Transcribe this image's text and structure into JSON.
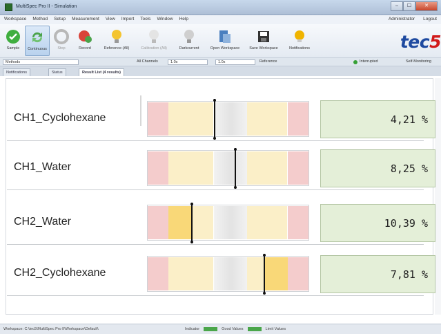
{
  "window": {
    "title": "MultiSpec Pro II - Simulation",
    "controls": [
      "–",
      "☐",
      "✕"
    ]
  },
  "menu": {
    "items": [
      "Workspace",
      "Method",
      "Setup",
      "Measurement",
      "View",
      "Import",
      "Tools",
      "Window",
      "Help"
    ],
    "right": [
      "Administrator",
      "Logout"
    ]
  },
  "toolbar": {
    "buttons": [
      {
        "label": "Sample",
        "icon": "green-check-icon",
        "color": "#3fae3f"
      },
      {
        "label": "Continuous",
        "icon": "refresh-icon",
        "color": "#4aa34a"
      },
      {
        "label": "Stop",
        "icon": "stop-icon",
        "color": "#b8b8b8"
      },
      {
        "label": "Record",
        "icon": "record-icon",
        "color": "#d9443a"
      },
      {
        "label": "Reference (All)",
        "icon": "bulb-icon",
        "color": "#f4c430"
      },
      {
        "label": "Calibration (All)",
        "icon": "bulb-icon",
        "color": "#e0e0e0"
      },
      {
        "label": "Darkcurrent",
        "icon": "bulb-icon",
        "color": "#c9c9c9"
      },
      {
        "label": "Open Workspace",
        "icon": "folder-icon",
        "color": "#4a7fbf"
      },
      {
        "label": "Save Workspace",
        "icon": "save-icon",
        "color": "#333333"
      },
      {
        "label": "Notifications",
        "icon": "bell-icon",
        "color": "#f0b400"
      }
    ],
    "logo": "tec5",
    "logo_highlight": "5"
  },
  "channel_bar": {
    "selector": "Methods",
    "all_channels_label": "All Channels",
    "field_a": "1.0s",
    "field_b": "1.0s",
    "reference_label": "Reference",
    "status": "Interrupted",
    "status_right": "Self-Monitoring"
  },
  "tabs": [
    {
      "label": "Notifications",
      "active": false
    },
    {
      "label": "Status",
      "active": false
    },
    {
      "label": "Result List (4 results)",
      "active": true
    }
  ],
  "results": [
    {
      "name": "CH1_Cyclohexane",
      "value": "4,21 %",
      "marker_fraction": 0.41,
      "highlight": "none"
    },
    {
      "name": "CH1_Water",
      "value": "8,25 %",
      "marker_fraction": 0.54,
      "highlight": "none"
    },
    {
      "name": "CH2_Water",
      "value": "10,39 %",
      "marker_fraction": 0.27,
      "highlight": "left"
    },
    {
      "name": "CH2_Cyclohexane",
      "value": "7,81 %",
      "marker_fraction": 0.72,
      "highlight": "right"
    }
  ],
  "colors": {
    "red_zone": "#f4cccc",
    "yellow_zone": "#fbefc8",
    "yellow_highlight": "#f9d878",
    "gray_zone": "#ececec",
    "value_bg": "#e4efd8"
  },
  "status_bar": {
    "left": "Workspace: C:\\tec5\\MultiSpec Pro II\\Workspace\\Default\\",
    "items": [
      "Indicator",
      "Good Values",
      "Limit Values"
    ]
  }
}
